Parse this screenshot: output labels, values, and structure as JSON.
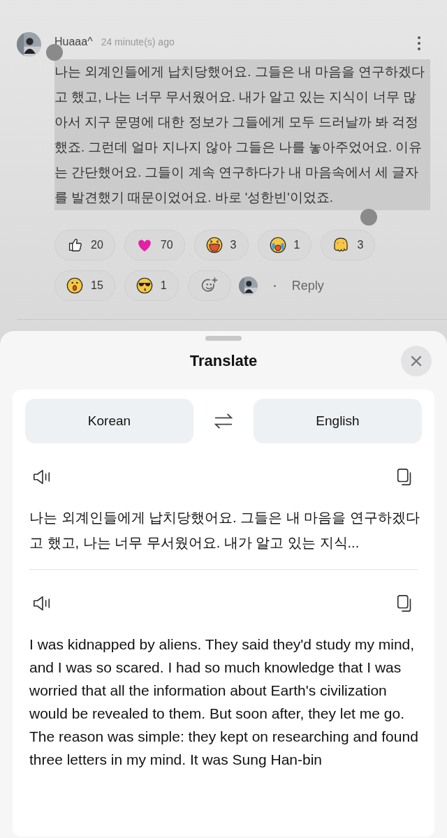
{
  "comment": {
    "author": "Huaaa^",
    "time": "24 minute(s) ago",
    "text": "나는 외계인들에게 납치당했어요. 그들은 내 마음을 연구하겠다고 했고, 나는 너무 무서웠어요. 내가 알고 있는 지식이 너무 많아서 지구 문명에 대한 정보가 그들에게 모두 드러날까 봐 걱정했죠. 그런데 얼마 지나지 않아 그들은 나를 놓아주었어요. 이유는 간단했어요. 그들이 계속 연구하다가 내 마음속에서 세 글자를 발견했기 때문이었어요. 바로 '성한빈'이었죠.",
    "text_selected": true,
    "reactions": [
      {
        "kind": "thumbs",
        "count": "20"
      },
      {
        "kind": "heart",
        "count": "70"
      },
      {
        "kind": "laugh",
        "count": "3"
      },
      {
        "kind": "cry",
        "count": "1"
      },
      {
        "kind": "melt",
        "count": "3"
      },
      {
        "kind": "surprised",
        "count": "15"
      },
      {
        "kind": "cool",
        "count": "1"
      }
    ],
    "reply": "Reply"
  },
  "translate": {
    "title": "Translate",
    "source_language": "Korean",
    "target_language": "English",
    "source_text": "나는 외계인들에게 납치당했어요. 그들은 내 마음을 연구하겠다고 했고, 나는 너무 무서웠어요. 내가 알고 있는 지식...",
    "translated_text": "I was kidnapped by aliens. They said they'd study my mind, and I was so scared. I had so much knowledge that I was worried that all the information about Earth's civilization would be revealed to them. But soon after, they let me go. The reason was simple: they kept on researching and found three letters in my mind. It was Sung Han-bin"
  }
}
